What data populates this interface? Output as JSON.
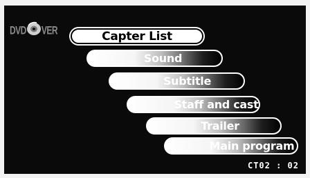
{
  "logo": {
    "text_left": "DVD",
    "text_right": "VER",
    "icon": "disc-icon"
  },
  "menu": {
    "items": [
      {
        "label": "Capter List",
        "selected": true
      },
      {
        "label": "Sound",
        "selected": false
      },
      {
        "label": "Subtitle",
        "selected": false
      },
      {
        "label": "Staff and cast",
        "selected": false
      },
      {
        "label": "Trailer",
        "selected": false
      },
      {
        "label": "Main program",
        "selected": false
      }
    ]
  },
  "status": {
    "chapter": "CT02 : 02"
  },
  "colors": {
    "background": "#0a0a0a",
    "selected_fill": "#ffffff",
    "text_light": "#ffffff",
    "text_dark": "#000000"
  }
}
